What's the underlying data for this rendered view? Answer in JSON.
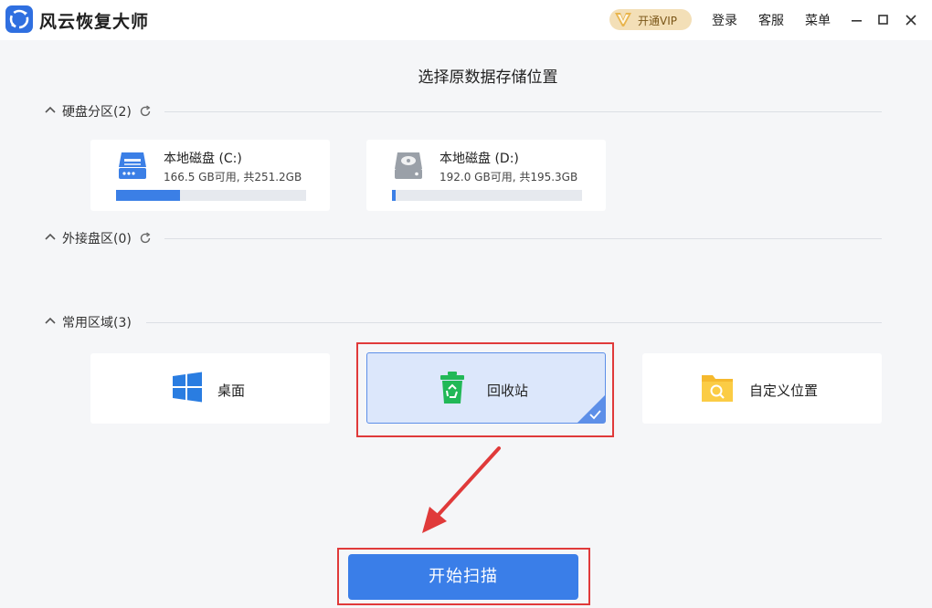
{
  "app": {
    "title": "风云恢复大师"
  },
  "header": {
    "vip_label": "开通VIP",
    "login": "登录",
    "service": "客服",
    "menu": "菜单"
  },
  "page": {
    "title": "选择原数据存储位置"
  },
  "sections": {
    "disks": {
      "label": "硬盘分区(2)"
    },
    "external": {
      "label": "外接盘区(0)"
    },
    "common": {
      "label": "常用区域(3)"
    }
  },
  "disks": [
    {
      "name": "本地磁盘 (C:)",
      "info": "166.5 GB可用, 共251.2GB",
      "used_fraction": 0.337,
      "icon": "hard-drive-icon",
      "color": "#3b7fe6"
    },
    {
      "name": "本地磁盘 (D:)",
      "info": "192.0 GB可用, 共195.3GB",
      "used_fraction": 0.017,
      "icon": "hard-drive-icon",
      "color": "#9aa0a8"
    }
  ],
  "common_areas": [
    {
      "label": "桌面",
      "icon": "windows-icon",
      "selected": false
    },
    {
      "label": "回收站",
      "icon": "recycle-bin-icon",
      "selected": true
    },
    {
      "label": "自定义位置",
      "icon": "folder-search-icon",
      "selected": false
    }
  ],
  "actions": {
    "scan_label": "开始扫描"
  },
  "colors": {
    "accent": "#3a7ee8",
    "highlight": "#e03a3a",
    "selected_bg": "#dce7fb"
  }
}
